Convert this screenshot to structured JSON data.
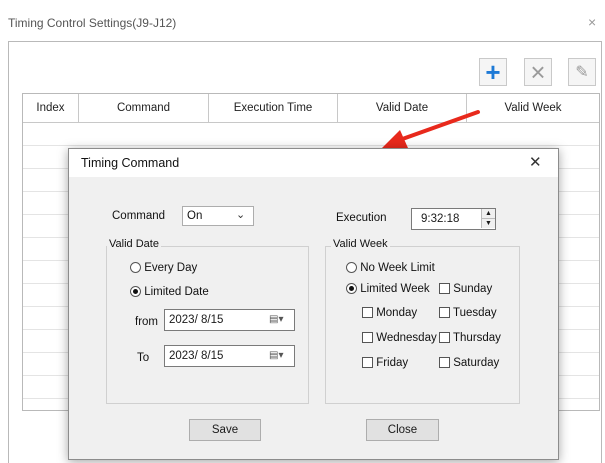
{
  "outer_window": {
    "title": "Timing Control Settings(J9-J12)",
    "close": "×",
    "toolbar": {
      "add": "+",
      "delete": "×",
      "edit": "✎"
    },
    "table": {
      "columns": [
        "Index",
        "Command",
        "Execution Time",
        "Valid Date",
        "Valid Week"
      ]
    }
  },
  "dialog": {
    "title": "Timing Command",
    "close": "✕",
    "command_label": "Command",
    "command_value": "On",
    "execution_label": "Execution",
    "execution_value": "9:32:18",
    "valid_date": {
      "title": "Valid Date",
      "every_day": "Every Day",
      "limited_date": "Limited Date",
      "from_label": "from",
      "from_value": "2023/ 8/15",
      "to_label": "To",
      "to_value": "2023/ 8/15"
    },
    "valid_week": {
      "title": "Valid Week",
      "no_week_limit": "No Week Limit",
      "limited_week": "Limited Week",
      "days": [
        "Sunday",
        "Monday",
        "Tuesday",
        "Wednesday",
        "Thursday",
        "Friday",
        "Saturday"
      ]
    },
    "save": "Save",
    "close_button": "Close"
  },
  "colors": {
    "accent": "#1e7ad6",
    "arrow": "#e8291c"
  }
}
